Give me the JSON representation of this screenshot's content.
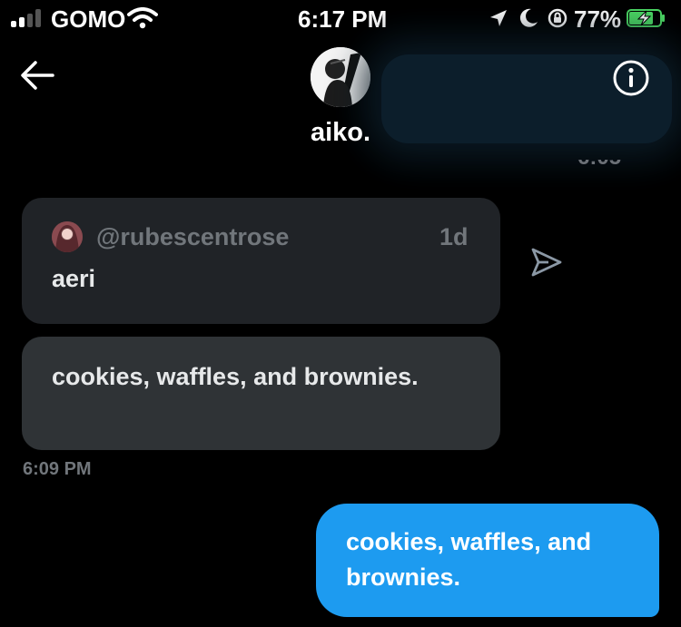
{
  "status_bar": {
    "carrier": "GOMO",
    "time": "6:17 PM",
    "battery_percent": "77%",
    "signal_bars": 2,
    "icons": [
      "signal-icon",
      "wifi-icon",
      "location-arrow-icon",
      "moon-icon",
      "rotation-lock-icon",
      "battery-charging-icon"
    ]
  },
  "header": {
    "title": "aiko.",
    "back_icon": "arrow-left-icon",
    "info_icon": "info-icon"
  },
  "conversation": {
    "quoted_tweet": {
      "handle": "@rubescentrose",
      "age": "1d",
      "text": "aeri",
      "share_icon": "send-icon"
    },
    "incoming_message": {
      "text": "cookies, waffles, and brownies.",
      "timestamp": "6:09 PM"
    },
    "outgoing_message": {
      "text": "cookies, waffles, and brownies."
    }
  },
  "colors": {
    "background": "#000000",
    "bubble_in": "#2f3336",
    "quote_bg": "#202327",
    "accent": "#1d9bf0",
    "muted_text": "#71767b"
  }
}
